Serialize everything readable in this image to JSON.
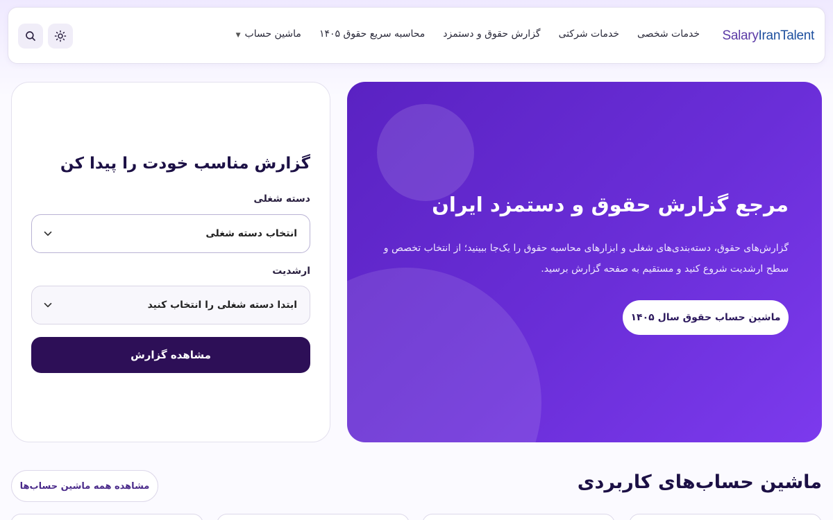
{
  "brand": {
    "part1": "Salary",
    "part2": "IranTalent"
  },
  "nav": {
    "items": [
      "خدمات شخصی",
      "خدمات شرکتی",
      "گزارش حقوق و دستمزد",
      "محاسبه سریع حقوق ۱۴۰۵"
    ],
    "dropdown": "ماشین حساب"
  },
  "icons": {
    "theme": "sun-icon",
    "search": "search-icon",
    "chevron": "chevron-down-icon"
  },
  "hero": {
    "title": "مرجع گزارش حقوق و دستمزد ایران",
    "description": "گزارش‌های حقوق، دسته‌بندی‌های شغلی و ابزارهای محاسبه حقوق را یک‌جا ببینید؛ از انتخاب تخصص و سطح ارشدیت شروع کنید و مستقیم به صفحه گزارش برسید.",
    "cta": "ماشین حساب حقوق سال ۱۴۰۵"
  },
  "finder": {
    "title": "گزارش مناسب خودت را پیدا کن",
    "category_label": "دسته شغلی",
    "category_value": "انتخاب دسته شغلی",
    "seniority_label": "ارشدیت",
    "seniority_value": "ابتدا دسته شغلی را انتخاب کنید",
    "submit": "مشاهده گزارش"
  },
  "calculators": {
    "title": "ماشین حساب‌های کاربردی",
    "view_all": "مشاهده همه ماشین حساب‌ها"
  },
  "colors": {
    "primary": "#5a22c2",
    "dark": "#2d0f57",
    "accent": "#7c3aed"
  }
}
